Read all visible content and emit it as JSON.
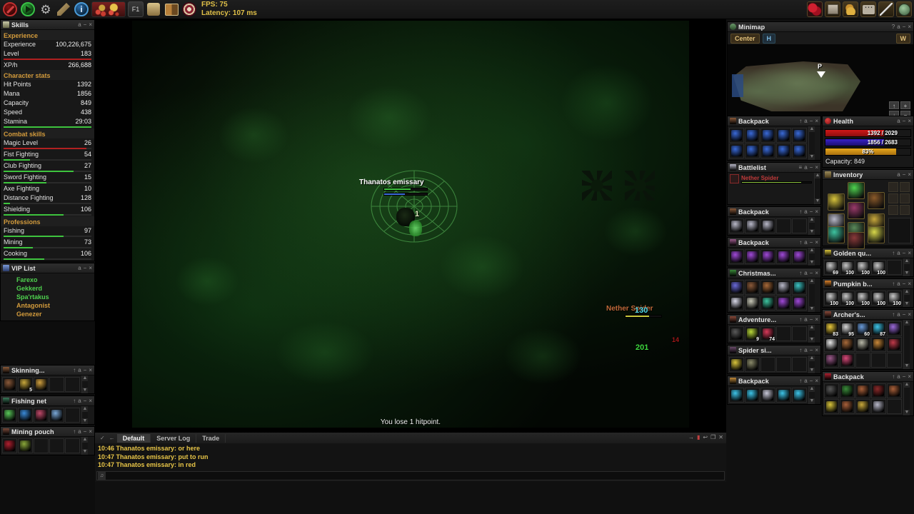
{
  "toolbar": {
    "left_buttons": [
      {
        "name": "stop-button",
        "icon": "stop-icon"
      },
      {
        "name": "start-button",
        "icon": "play-icon"
      },
      {
        "name": "settings-button",
        "icon": "gear-icon"
      },
      {
        "name": "edit-button",
        "icon": "pencil-icon"
      },
      {
        "name": "info-button",
        "icon": "info-icon"
      },
      {
        "name": "loot-button",
        "icon": "loot-pile-icon"
      },
      {
        "name": "hotkey-f1-button",
        "label": "F1"
      },
      {
        "name": "scroll-button",
        "icon": "scroll-icon"
      },
      {
        "name": "book-button",
        "icon": "book-icon"
      },
      {
        "name": "target-button",
        "icon": "target-icon"
      }
    ],
    "fps_label": "FPS: 75",
    "latency_label": "Latency: 107 ms",
    "right_buttons": [
      {
        "name": "hearts-button",
        "icon": "hearts-icon"
      },
      {
        "name": "chest-button",
        "icon": "chest-icon"
      },
      {
        "name": "gold-button",
        "icon": "gold-pile-icon"
      },
      {
        "name": "chat-button",
        "icon": "speech-bubble-icon"
      },
      {
        "name": "sword-button",
        "icon": "sword-icon"
      },
      {
        "name": "shield-button",
        "icon": "shield-icon"
      }
    ]
  },
  "skills": {
    "title": "Skills",
    "buttons": [
      "a",
      "−",
      "×"
    ],
    "sections": [
      {
        "label": "Experience",
        "rows": [
          {
            "name": "Experience",
            "value": "100,226,675",
            "bar": null
          },
          {
            "name": "Level",
            "value": "183",
            "bar": {
              "pct": 100,
              "color": "#b02020"
            }
          },
          {
            "name": "XP/h",
            "value": "266,688",
            "bar": null
          }
        ]
      },
      {
        "label": "Character stats",
        "rows": [
          {
            "name": "Hit Points",
            "value": "1392",
            "bar": null
          },
          {
            "name": "Mana",
            "value": "1856",
            "bar": null
          },
          {
            "name": "Capacity",
            "value": "849",
            "bar": null
          },
          {
            "name": "Speed",
            "value": "438",
            "bar": null
          },
          {
            "name": "Stamina",
            "value": "29:03",
            "bar": {
              "pct": 100,
              "color": "#3ec43e"
            }
          }
        ]
      },
      {
        "label": "Combat skills",
        "rows": [
          {
            "name": "Magic Level",
            "value": "26",
            "bar": {
              "pct": 94,
              "color": "#b02020"
            }
          },
          {
            "name": "Fist Fighting",
            "value": "54",
            "bar": {
              "pct": 30,
              "color": "#3ec43e"
            }
          },
          {
            "name": "Club Fighting",
            "value": "27",
            "bar": {
              "pct": 80,
              "color": "#3ec43e"
            }
          },
          {
            "name": "Sword Fighting",
            "value": "15",
            "bar": {
              "pct": 49,
              "color": "#3ec43e"
            }
          },
          {
            "name": "Axe Fighting",
            "value": "10",
            "bar": null
          },
          {
            "name": "Distance Fighting",
            "value": "128",
            "bar": {
              "pct": 7,
              "color": "#3ec43e"
            }
          },
          {
            "name": "Shielding",
            "value": "106",
            "bar": {
              "pct": 68,
              "color": "#3ec43e"
            }
          }
        ]
      },
      {
        "label": "Professions",
        "rows": [
          {
            "name": "Fishing",
            "value": "97",
            "bar": {
              "pct": 68,
              "color": "#3ec43e"
            }
          },
          {
            "name": "Mining",
            "value": "73",
            "bar": {
              "pct": 33,
              "color": "#3ec43e"
            }
          },
          {
            "name": "Cooking",
            "value": "106",
            "bar": {
              "pct": 46,
              "color": "#3ec43e"
            }
          }
        ]
      }
    ]
  },
  "vip": {
    "title": "VIP List",
    "members": [
      {
        "name": "Farexo",
        "color": "#4fd24f"
      },
      {
        "name": "Gekkerd",
        "color": "#4fd24f"
      },
      {
        "name": "Spa'rtakus",
        "color": "#4fd24f"
      },
      {
        "name": "Antagonist",
        "color": "#d39b3c"
      },
      {
        "name": "Genezer",
        "color": "#d39b3c"
      }
    ]
  },
  "left_containers": [
    {
      "title": "Skinning...",
      "icon_color": "#8a5a3a",
      "slots": [
        {
          "color": "#8a5a3a",
          "count": ""
        },
        {
          "color": "#c8a83c",
          "count": "5"
        },
        {
          "color": "#d0a040",
          "count": ""
        },
        {
          "color": "",
          "count": ""
        },
        {
          "color": "",
          "count": ""
        }
      ]
    },
    {
      "title": "Fishing net",
      "icon_color": "#3a7a5a",
      "slots": [
        {
          "color": "#5ac85a",
          "count": ""
        },
        {
          "color": "#3a8ad8",
          "count": ""
        },
        {
          "color": "#c04a6a",
          "count": ""
        },
        {
          "color": "#7aa8d8",
          "count": ""
        },
        {
          "color": "",
          "count": ""
        }
      ]
    },
    {
      "title": "Mining pouch",
      "icon_color": "#7a4a3a",
      "slots": [
        {
          "color": "#b02030",
          "count": ""
        },
        {
          "color": "#8aa83a",
          "count": ""
        },
        {
          "color": "",
          "count": ""
        },
        {
          "color": "",
          "count": ""
        },
        {
          "color": "",
          "count": ""
        }
      ]
    }
  ],
  "gameview": {
    "player": {
      "name": "Thanatos emissary",
      "hp_pct": 62,
      "hp_color": "#3ec43e",
      "mana_pct": 48,
      "mana_color": "#3a6ad8",
      "damage_label": "1"
    },
    "monster": {
      "name": "Nether Spider",
      "name_color": "#c06a3a",
      "hp_pct": 65,
      "hp_color": "#c8c83c",
      "damage_labels": [
        {
          "text": "130",
          "color": "#4fd8e8"
        },
        {
          "text": "201",
          "color": "#3ed83e"
        },
        {
          "text": "14",
          "color": "#a01818"
        }
      ]
    },
    "status_message": "You lose 1 hitpoint."
  },
  "chat": {
    "tabs": [
      {
        "label": "Default",
        "active": true
      },
      {
        "label": "Server Log",
        "active": false
      },
      {
        "label": "Trade",
        "active": false
      }
    ],
    "lines": [
      {
        "text": "10:46 Thanatos emissary: or here",
        "color": "#e8c547"
      },
      {
        "text": "10:47 Thanatos emissary: put to run",
        "color": "#e8c547"
      },
      {
        "text": "10:47 Thanatos emissary: in red",
        "color": "#e8c547"
      }
    ],
    "input_value": "",
    "right_icons": [
      "→",
      "▮",
      "↩",
      "❐",
      "✕"
    ],
    "left_icons": [
      "✓",
      "←"
    ]
  },
  "minimap": {
    "title": "Minimap",
    "buttons": [
      "?",
      "a",
      "−",
      "×"
    ],
    "center_label": "Center",
    "h_label": "H",
    "w_label": "W",
    "marker_label": "P",
    "nav_buttons": [
      "↑",
      "+",
      "↓",
      "−"
    ]
  },
  "health": {
    "title": "Health",
    "buttons": [
      "a",
      "−",
      "×"
    ],
    "hp_text": "1392 / 2029",
    "hp_pct": 69,
    "hp_color": "#d21818",
    "mana_text": "1856 / 2683",
    "mana_pct": 69,
    "mana_color": "#3820c8",
    "stamina_text": "83%",
    "stamina_pct": 83,
    "stamina_color": "#e8a81c",
    "capacity_text": "Capacity: 849"
  },
  "battlelist": {
    "title": "Battlelist",
    "buttons": [
      "≡",
      "a",
      "−",
      "×"
    ],
    "target_name": "Nether Spider",
    "target_hp_pct": 86
  },
  "inventory": {
    "title": "Inventory",
    "buttons": [
      "a",
      "−",
      "×"
    ],
    "equipment": [
      {
        "slot": "helmet",
        "color": "#4fd24f"
      },
      {
        "slot": "amulet",
        "color": "#d8c43c"
      },
      {
        "slot": "backpack",
        "color": "#8a5a2a"
      },
      {
        "slot": "armor",
        "color": "#9a3a6a"
      },
      {
        "slot": "left-hand",
        "color": "#b8b8c8"
      },
      {
        "slot": "right-hand",
        "color": "#c8a83c"
      },
      {
        "slot": "legs",
        "color": "#5a8a5a"
      },
      {
        "slot": "ring",
        "color": "#3ec4a0"
      },
      {
        "slot": "boots",
        "color": "#8a3a3a"
      },
      {
        "slot": "arrow",
        "color": "#d8d84a"
      }
    ],
    "side_buttons": [
      "sword-icon",
      "hand-icon",
      "bow-icon",
      "run-icon",
      "shield-icon",
      "skull-icon"
    ]
  },
  "right_containers": [
    {
      "title": "Backpack",
      "icon_color": "#8a5a3a",
      "rows": 2,
      "cols": 5,
      "slots": [
        {
          "color": "#3a6ad8",
          "count": ""
        },
        {
          "color": "#3a6ad8",
          "count": ""
        },
        {
          "color": "#3a6ad8",
          "count": ""
        },
        {
          "color": "#3a6ad8",
          "count": ""
        },
        {
          "color": "#3a6ad8",
          "count": ""
        },
        {
          "color": "#3a6ad8",
          "count": ""
        },
        {
          "color": "#3a6ad8",
          "count": ""
        },
        {
          "color": "#3a6ad8",
          "count": ""
        },
        {
          "color": "#3a6ad8",
          "count": ""
        },
        {
          "color": "#3a6ad8",
          "count": ""
        }
      ]
    },
    {
      "title": "Backpack",
      "icon_color": "#8a5a3a",
      "rows": 1,
      "cols": 5,
      "slots": [
        {
          "color": "#b8b8c8",
          "count": ""
        },
        {
          "color": "#b8b8c8",
          "count": ""
        },
        {
          "color": "#b8b8c8",
          "count": ""
        },
        {
          "color": "",
          "count": ""
        },
        {
          "color": "",
          "count": ""
        }
      ]
    },
    {
      "title": "Backpack",
      "icon_color": "#9a5a8a",
      "rows": 1,
      "cols": 5,
      "slots": [
        {
          "color": "#a04ad8",
          "count": ""
        },
        {
          "color": "#a04ad8",
          "count": ""
        },
        {
          "color": "#a04ad8",
          "count": ""
        },
        {
          "color": "#a04ad8",
          "count": ""
        },
        {
          "color": "#a04ad8",
          "count": ""
        }
      ]
    },
    {
      "title": "Christmas...",
      "icon_color": "#3a8a3a",
      "rows": 2,
      "cols": 5,
      "slots": [
        {
          "color": "#6a6ad8",
          "count": ""
        },
        {
          "color": "#8a5a3a",
          "count": ""
        },
        {
          "color": "#a86a3a",
          "count": ""
        },
        {
          "color": "#b8b8c8",
          "count": ""
        },
        {
          "color": "#3ec4c4",
          "count": ""
        },
        {
          "color": "#d8d8e8",
          "count": ""
        },
        {
          "color": "#c8c8b8",
          "count": ""
        },
        {
          "color": "#3ec4a0",
          "count": ""
        },
        {
          "color": "#a04ad8",
          "count": ""
        },
        {
          "color": "#a04ad8",
          "count": ""
        }
      ]
    },
    {
      "title": "Adventure...",
      "icon_color": "#8a4a3a",
      "rows": 1,
      "cols": 5,
      "slots": [
        {
          "color": "#5a5a5a",
          "count": ""
        },
        {
          "color": "#b8d83a",
          "count": "9"
        },
        {
          "color": "#d83a5a",
          "count": "74"
        },
        {
          "color": "",
          "count": ""
        },
        {
          "color": "",
          "count": ""
        }
      ]
    },
    {
      "title": "Spider si...",
      "icon_color": "#6a4a6a",
      "rows": 1,
      "cols": 5,
      "slots": [
        {
          "color": "#d8c43c",
          "count": ""
        },
        {
          "color": "#8a8a6a",
          "count": ""
        },
        {
          "color": "",
          "count": ""
        },
        {
          "color": "",
          "count": ""
        },
        {
          "color": "",
          "count": ""
        }
      ]
    },
    {
      "title": "Backpack",
      "icon_color": "#c08a3a",
      "rows": 1,
      "cols": 5,
      "slots": [
        {
          "color": "#3ec4e8",
          "count": ""
        },
        {
          "color": "#3ec4e8",
          "count": ""
        },
        {
          "color": "#c8c8d8",
          "count": ""
        },
        {
          "color": "#3ec4e8",
          "count": ""
        },
        {
          "color": "#3ec4e8",
          "count": ""
        }
      ]
    }
  ],
  "quivers": [
    {
      "title": "Golden qu...",
      "icon_color": "#d8c43c",
      "rows": 1,
      "cols": 5,
      "slots": [
        {
          "color": "#c8c8c8",
          "count": "69"
        },
        {
          "color": "#c8c8c8",
          "count": "100"
        },
        {
          "color": "#c8c8c8",
          "count": "100"
        },
        {
          "color": "#c8c8c8",
          "count": "100"
        },
        {
          "color": "",
          "count": ""
        }
      ]
    },
    {
      "title": "Pumpkin b...",
      "icon_color": "#d8802a",
      "rows": 1,
      "cols": 5,
      "slots": [
        {
          "color": "#c8c8c8",
          "count": "100"
        },
        {
          "color": "#c8c8c8",
          "count": "100"
        },
        {
          "color": "#c8c8c8",
          "count": "100"
        },
        {
          "color": "#c8c8c8",
          "count": "100"
        },
        {
          "color": "#c8c8c8",
          "count": "100"
        }
      ]
    },
    {
      "title": "Archer's...",
      "icon_color": "#8a4a3a",
      "rows": 3,
      "cols": 5,
      "slots": [
        {
          "color": "#e8c83c",
          "count": "83"
        },
        {
          "color": "#d8d8d8",
          "count": "95"
        },
        {
          "color": "#6a9ad8",
          "count": "60"
        },
        {
          "color": "#3ec4e8",
          "count": "87"
        },
        {
          "color": "#9a6ad8",
          "count": ""
        },
        {
          "color": "#e8e8e8",
          "count": ""
        },
        {
          "color": "#a86a3a",
          "count": ""
        },
        {
          "color": "#b8b8a8",
          "count": ""
        },
        {
          "color": "#c8883a",
          "count": ""
        },
        {
          "color": "#c03a4a",
          "count": ""
        },
        {
          "color": "#9a5a8a",
          "count": ""
        },
        {
          "color": "#d84a7a",
          "count": ""
        },
        {
          "color": "",
          "count": ""
        },
        {
          "color": "",
          "count": ""
        },
        {
          "color": "",
          "count": ""
        }
      ]
    },
    {
      "title": "Backpack",
      "icon_color": "#b02030",
      "rows": 2,
      "cols": 5,
      "slots": [
        {
          "color": "#5a5a5a",
          "count": ""
        },
        {
          "color": "#3a8a3a",
          "count": ""
        },
        {
          "color": "#a8603a",
          "count": ""
        },
        {
          "color": "#8a2a2a",
          "count": ""
        },
        {
          "color": "#a8603a",
          "count": ""
        },
        {
          "color": "#d8c43c",
          "count": ""
        },
        {
          "color": "#a8603a",
          "count": ""
        },
        {
          "color": "#c8a83c",
          "count": ""
        },
        {
          "color": "#b8b8c8",
          "count": ""
        },
        {
          "color": "",
          "count": ""
        }
      ]
    }
  ]
}
